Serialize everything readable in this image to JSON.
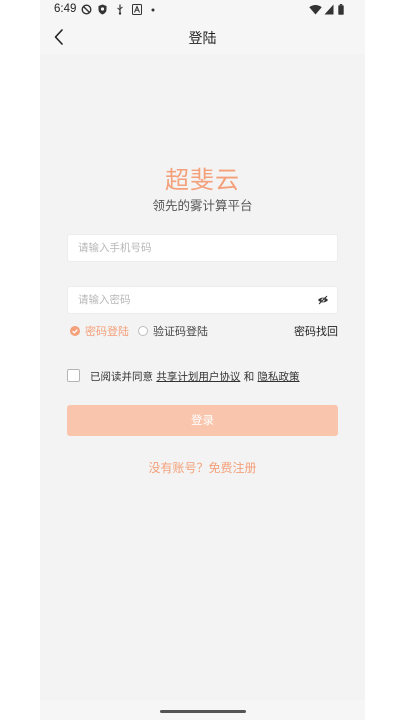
{
  "status_bar": {
    "time": "6:49"
  },
  "nav": {
    "title": "登陆"
  },
  "brand": {
    "name": "超斐云",
    "tagline": "领先的雾计算平台"
  },
  "form": {
    "phone_placeholder": "请输入手机号码",
    "password_placeholder": "请输入密码",
    "mode_password": "密码登陆",
    "mode_sms": "验证码登陆",
    "forgot_password": "密码找回",
    "agree_prefix": "已阅读并同意",
    "agreement_link": "共享计划用户协议",
    "agree_and": "和",
    "privacy_link": "隐私政策",
    "login_button": "登录",
    "register_link": "没有账号？免费注册"
  },
  "colors": {
    "accent": "#f4a07a",
    "button_disabled": "#f9c5ac",
    "background": "#f3f3f3"
  },
  "icons": {
    "back": "chevron-left-icon",
    "eye": "eye-off-icon",
    "radio_checked": "check-circle-icon"
  }
}
